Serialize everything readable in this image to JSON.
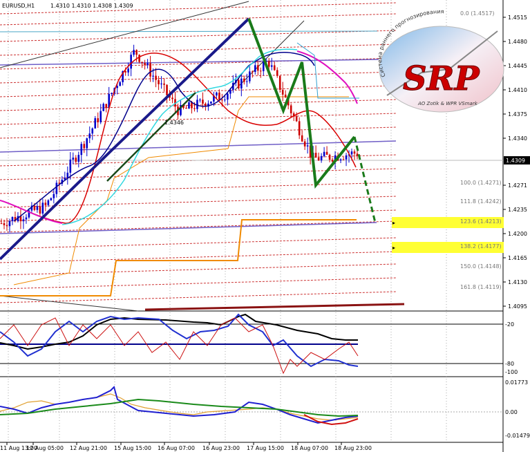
{
  "header": {
    "symbol_tf": "EURUSD,H1",
    "ohlc": "1.4310 1.4310 1.4308 1.4309"
  },
  "price_axis": {
    "labels": [
      "1.4515",
      "1.4480",
      "1.4445",
      "1.4410",
      "1.4375",
      "1.4340",
      "1.4271",
      "1.4235",
      "1.4200",
      "1.4165",
      "1.4130",
      "1.4095"
    ],
    "current": "1.4309"
  },
  "osc1_axis": {
    "labels": [
      "-20",
      "-80",
      "-100"
    ]
  },
  "osc2_axis": {
    "labels": [
      "0.01773",
      "0.00",
      "-0.01479"
    ]
  },
  "time_axis": {
    "labels": [
      "11 Aug 13:00",
      "12 Aug 05:00",
      "12 Aug 21:00",
      "15 Aug 15:00",
      "16 Aug 07:00",
      "16 Aug 23:00",
      "17 Aug 15:00",
      "18 Aug 07:00",
      "18 Aug 23:00"
    ]
  },
  "fibo_labels": [
    "0.0 (1.4517)",
    "100.0 (1.4271)",
    "111.8 (1.4242)",
    "123.6 (1.4213)",
    "138.2 (1.4177)",
    "150.0 (1.4148)",
    "161.8 (1.4119)"
  ],
  "candle_label": "1.4346",
  "logo": {
    "letters": "SRP",
    "arc_text": "Система раннего прогнозирования",
    "credit": "AO Zotik & WPR VSmark"
  },
  "colors": {
    "bull": "#0000cc",
    "bear": "#cc0000",
    "highlight": "#ffff33",
    "wave": "#1a7a1a"
  },
  "chart_data": {
    "type": "line",
    "title": "EURUSD,H1",
    "ylim": [
      1.4075,
      1.4535
    ],
    "x": [
      "11 Aug 13:00",
      "12 Aug 05:00",
      "12 Aug 21:00",
      "15 Aug 15:00",
      "16 Aug 07:00",
      "16 Aug 23:00",
      "17 Aug 15:00",
      "18 Aug 07:00",
      "18 Aug 23:00"
    ],
    "series": [
      {
        "values": [
          1.4205,
          1.423,
          1.434,
          1.446,
          1.437,
          1.4395,
          1.4445,
          1.43,
          1.4309
        ]
      }
    ]
  }
}
